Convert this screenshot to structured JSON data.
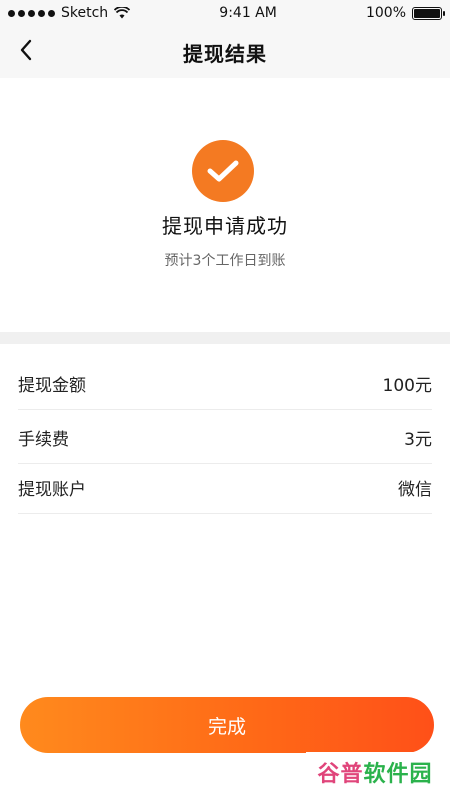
{
  "status_bar": {
    "carrier": "Sketch",
    "time": "9:41 AM",
    "battery": "100%",
    "battery_level": 1.0,
    "signal_icon": "signal-dots-icon",
    "wifi_icon": "wifi-icon",
    "battery_icon": "battery-icon"
  },
  "nav": {
    "title": "提现结果",
    "back_icon": "chevron-left-icon"
  },
  "result": {
    "icon": "checkmark-circle-icon",
    "icon_color": "#f47a22",
    "title": "提现申请成功",
    "subtitle": "预计3个工作日到账"
  },
  "details": {
    "rows": [
      {
        "label": "提现金额",
        "value": "100元"
      },
      {
        "label": "手续费",
        "value": "3元"
      },
      {
        "label": "提现账户",
        "value": "微信"
      }
    ]
  },
  "done_button": {
    "label": "完成",
    "gradient_start": "#ff8a1d",
    "gradient_end": "#ff5018"
  },
  "watermark": {
    "text_a": "谷普",
    "text_b": "软件园"
  }
}
